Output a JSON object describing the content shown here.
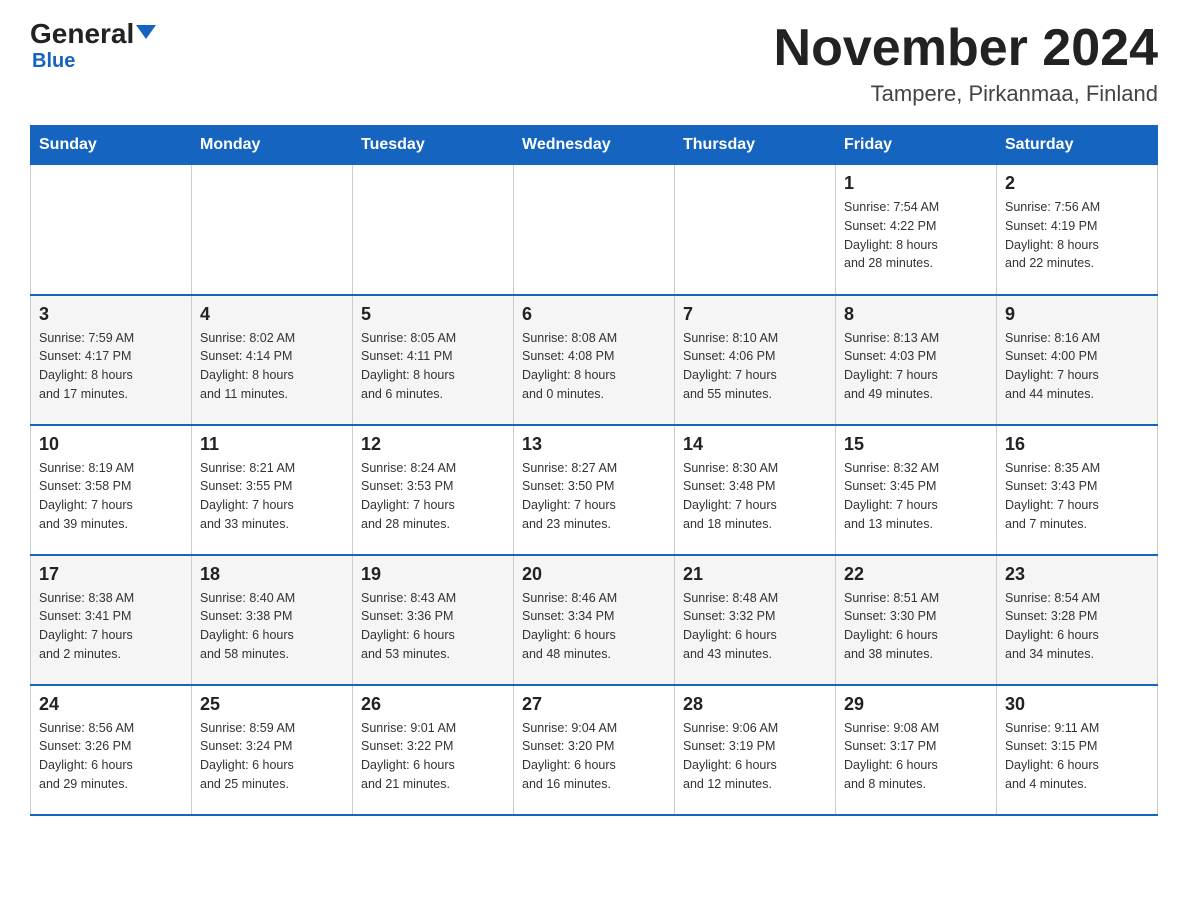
{
  "header": {
    "logo_main": "General",
    "logo_blue": "Blue",
    "month_title": "November 2024",
    "location": "Tampere, Pirkanmaa, Finland"
  },
  "days_of_week": [
    "Sunday",
    "Monday",
    "Tuesday",
    "Wednesday",
    "Thursday",
    "Friday",
    "Saturday"
  ],
  "weeks": [
    [
      {
        "day": "",
        "info": ""
      },
      {
        "day": "",
        "info": ""
      },
      {
        "day": "",
        "info": ""
      },
      {
        "day": "",
        "info": ""
      },
      {
        "day": "",
        "info": ""
      },
      {
        "day": "1",
        "info": "Sunrise: 7:54 AM\nSunset: 4:22 PM\nDaylight: 8 hours\nand 28 minutes."
      },
      {
        "day": "2",
        "info": "Sunrise: 7:56 AM\nSunset: 4:19 PM\nDaylight: 8 hours\nand 22 minutes."
      }
    ],
    [
      {
        "day": "3",
        "info": "Sunrise: 7:59 AM\nSunset: 4:17 PM\nDaylight: 8 hours\nand 17 minutes."
      },
      {
        "day": "4",
        "info": "Sunrise: 8:02 AM\nSunset: 4:14 PM\nDaylight: 8 hours\nand 11 minutes."
      },
      {
        "day": "5",
        "info": "Sunrise: 8:05 AM\nSunset: 4:11 PM\nDaylight: 8 hours\nand 6 minutes."
      },
      {
        "day": "6",
        "info": "Sunrise: 8:08 AM\nSunset: 4:08 PM\nDaylight: 8 hours\nand 0 minutes."
      },
      {
        "day": "7",
        "info": "Sunrise: 8:10 AM\nSunset: 4:06 PM\nDaylight: 7 hours\nand 55 minutes."
      },
      {
        "day": "8",
        "info": "Sunrise: 8:13 AM\nSunset: 4:03 PM\nDaylight: 7 hours\nand 49 minutes."
      },
      {
        "day": "9",
        "info": "Sunrise: 8:16 AM\nSunset: 4:00 PM\nDaylight: 7 hours\nand 44 minutes."
      }
    ],
    [
      {
        "day": "10",
        "info": "Sunrise: 8:19 AM\nSunset: 3:58 PM\nDaylight: 7 hours\nand 39 minutes."
      },
      {
        "day": "11",
        "info": "Sunrise: 8:21 AM\nSunset: 3:55 PM\nDaylight: 7 hours\nand 33 minutes."
      },
      {
        "day": "12",
        "info": "Sunrise: 8:24 AM\nSunset: 3:53 PM\nDaylight: 7 hours\nand 28 minutes."
      },
      {
        "day": "13",
        "info": "Sunrise: 8:27 AM\nSunset: 3:50 PM\nDaylight: 7 hours\nand 23 minutes."
      },
      {
        "day": "14",
        "info": "Sunrise: 8:30 AM\nSunset: 3:48 PM\nDaylight: 7 hours\nand 18 minutes."
      },
      {
        "day": "15",
        "info": "Sunrise: 8:32 AM\nSunset: 3:45 PM\nDaylight: 7 hours\nand 13 minutes."
      },
      {
        "day": "16",
        "info": "Sunrise: 8:35 AM\nSunset: 3:43 PM\nDaylight: 7 hours\nand 7 minutes."
      }
    ],
    [
      {
        "day": "17",
        "info": "Sunrise: 8:38 AM\nSunset: 3:41 PM\nDaylight: 7 hours\nand 2 minutes."
      },
      {
        "day": "18",
        "info": "Sunrise: 8:40 AM\nSunset: 3:38 PM\nDaylight: 6 hours\nand 58 minutes."
      },
      {
        "day": "19",
        "info": "Sunrise: 8:43 AM\nSunset: 3:36 PM\nDaylight: 6 hours\nand 53 minutes."
      },
      {
        "day": "20",
        "info": "Sunrise: 8:46 AM\nSunset: 3:34 PM\nDaylight: 6 hours\nand 48 minutes."
      },
      {
        "day": "21",
        "info": "Sunrise: 8:48 AM\nSunset: 3:32 PM\nDaylight: 6 hours\nand 43 minutes."
      },
      {
        "day": "22",
        "info": "Sunrise: 8:51 AM\nSunset: 3:30 PM\nDaylight: 6 hours\nand 38 minutes."
      },
      {
        "day": "23",
        "info": "Sunrise: 8:54 AM\nSunset: 3:28 PM\nDaylight: 6 hours\nand 34 minutes."
      }
    ],
    [
      {
        "day": "24",
        "info": "Sunrise: 8:56 AM\nSunset: 3:26 PM\nDaylight: 6 hours\nand 29 minutes."
      },
      {
        "day": "25",
        "info": "Sunrise: 8:59 AM\nSunset: 3:24 PM\nDaylight: 6 hours\nand 25 minutes."
      },
      {
        "day": "26",
        "info": "Sunrise: 9:01 AM\nSunset: 3:22 PM\nDaylight: 6 hours\nand 21 minutes."
      },
      {
        "day": "27",
        "info": "Sunrise: 9:04 AM\nSunset: 3:20 PM\nDaylight: 6 hours\nand 16 minutes."
      },
      {
        "day": "28",
        "info": "Sunrise: 9:06 AM\nSunset: 3:19 PM\nDaylight: 6 hours\nand 12 minutes."
      },
      {
        "day": "29",
        "info": "Sunrise: 9:08 AM\nSunset: 3:17 PM\nDaylight: 6 hours\nand 8 minutes."
      },
      {
        "day": "30",
        "info": "Sunrise: 9:11 AM\nSunset: 3:15 PM\nDaylight: 6 hours\nand 4 minutes."
      }
    ]
  ]
}
